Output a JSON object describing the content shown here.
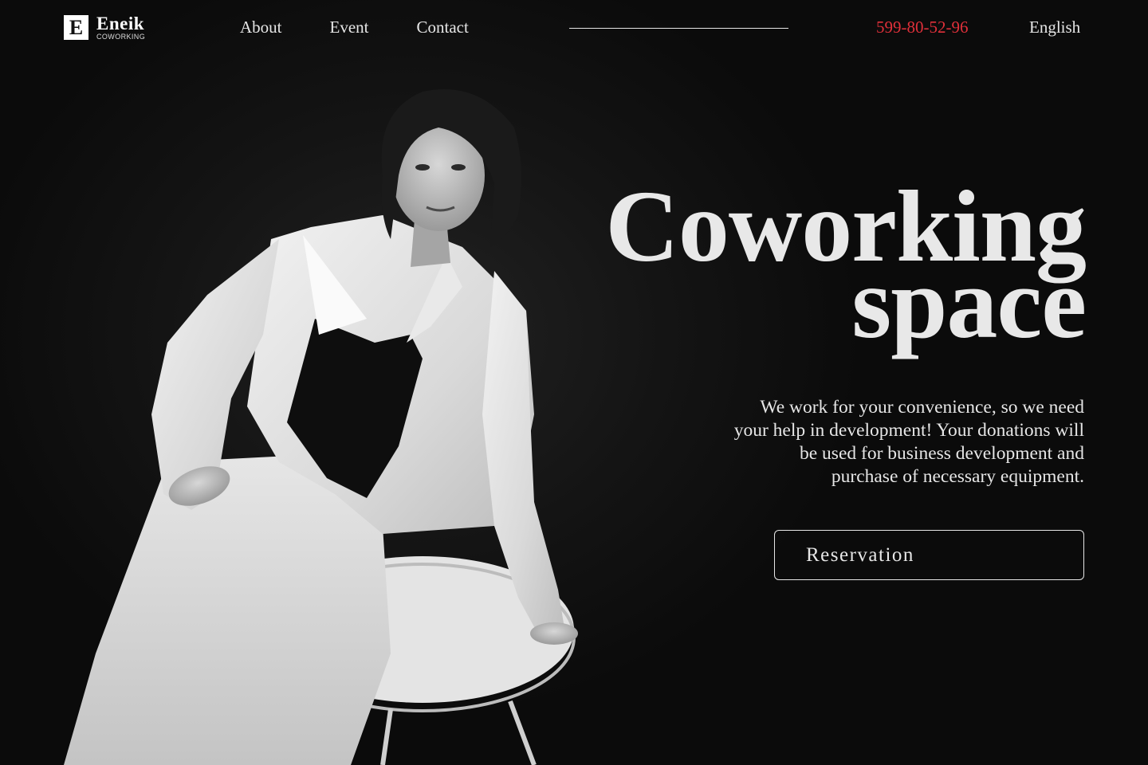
{
  "brand": {
    "logo_letter": "E",
    "name": "Eneik",
    "tagline": "COWORKING"
  },
  "nav": {
    "items": [
      {
        "label": "About"
      },
      {
        "label": "Event"
      },
      {
        "label": "Contact"
      }
    ]
  },
  "header": {
    "phone": "599-80-52-96",
    "language": "English"
  },
  "hero": {
    "title_line1": "Coworking",
    "title_line2": "space",
    "description": "We work for your convenience, so we need your help in development! Your donations will be used for business development and purchase of necessary equipment.",
    "button_label": "Reservation"
  },
  "colors": {
    "background": "#0b0b0b",
    "text": "#e6e6e6",
    "accent": "#e0303a"
  }
}
